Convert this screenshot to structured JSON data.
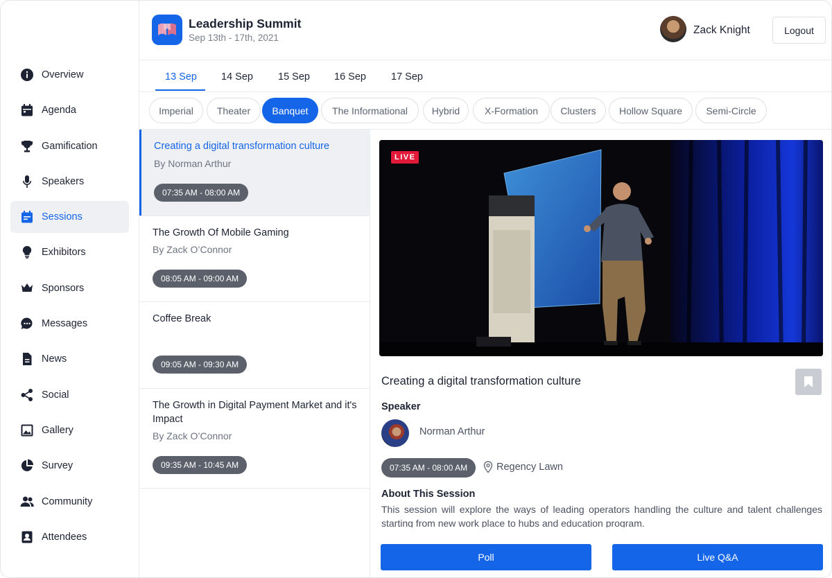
{
  "app": {
    "event_title": "Leadership Summit",
    "event_date": "Sep 13th - 17th, 2021",
    "user_name": "Zack Knight",
    "logout_label": "Logout"
  },
  "sidebar": {
    "active_index": 4,
    "items": [
      {
        "label": "Overview",
        "icon": "info-icon"
      },
      {
        "label": "Agenda",
        "icon": "calendar-icon"
      },
      {
        "label": "Gamification",
        "icon": "trophy-icon"
      },
      {
        "label": "Speakers",
        "icon": "microphone-icon"
      },
      {
        "label": "Sessions",
        "icon": "sessions-calendar-icon"
      },
      {
        "label": "Exhibitors",
        "icon": "lightbulb-icon"
      },
      {
        "label": "Sponsors",
        "icon": "crown-icon"
      },
      {
        "label": "Messages",
        "icon": "chat-icon"
      },
      {
        "label": "News",
        "icon": "document-icon"
      },
      {
        "label": "Social",
        "icon": "share-icon"
      },
      {
        "label": "Gallery",
        "icon": "image-icon"
      },
      {
        "label": "Survey",
        "icon": "pie-chart-icon"
      },
      {
        "label": "Community",
        "icon": "people-icon"
      },
      {
        "label": "Attendees",
        "icon": "badge-icon"
      }
    ]
  },
  "date_tabs": [
    "13 Sep",
    "14 Sep",
    "15 Sep",
    "16 Sep",
    "17 Sep"
  ],
  "active_date": "13 Sep",
  "rooms": [
    "Imperial",
    "Theater",
    "Banquet",
    "The Informational",
    "Hybrid",
    "X-Formation",
    "Clusters",
    "Hollow Square",
    "Semi-Circle"
  ],
  "active_room": "Banquet",
  "sessions": [
    {
      "title": "Creating a digital transformation culture",
      "by": "By Norman Arthur",
      "time": "07:35 AM - 08:00 AM"
    },
    {
      "title": "The Growth Of Mobile Gaming",
      "by": "By Zack O’Connor",
      "time": "08:05 AM - 09:00 AM"
    },
    {
      "title": "Coffee Break",
      "by": "",
      "time": "09:05 AM - 09:30 AM"
    },
    {
      "title": "The Growth in Digital Payment Market and it's Impact",
      "by": "By Zack O’Connor",
      "time": "09:35 AM - 10:45 AM"
    }
  ],
  "detail": {
    "live_badge": "LIVE",
    "title": "Creating a digital transformation culture",
    "speaker_heading": "Speaker",
    "speaker_name": "Norman Arthur",
    "time": "07:35 AM - 08:00 AM",
    "location": "Regency Lawn",
    "about_heading": "About This Session",
    "about_text": "This session will explore the ways of leading operators handling the culture and talent challenges starting from new work place to hubs and education program.",
    "poll_label": "Poll",
    "qa_label": "Live Q&A"
  },
  "colors": {
    "accent": "#1565e8",
    "live": "#e3193a",
    "pill": "#5b606b"
  }
}
